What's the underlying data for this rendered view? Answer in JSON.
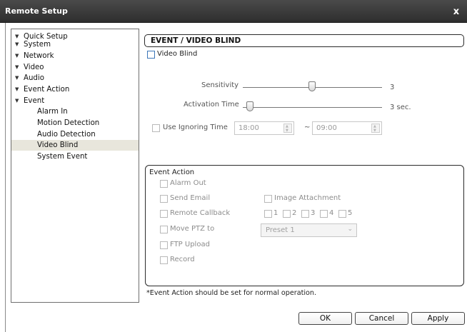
{
  "window": {
    "title": "Remote Setup",
    "close_glyph": "x"
  },
  "tree": {
    "items": [
      {
        "label": "Quick Setup",
        "arrow": "▼"
      },
      {
        "label": "System",
        "arrow": "▼"
      },
      {
        "label": "Network",
        "arrow": "▼"
      },
      {
        "label": "Video",
        "arrow": "▼"
      },
      {
        "label": "Audio",
        "arrow": "▼"
      },
      {
        "label": "Event Action",
        "arrow": "▼"
      },
      {
        "label": "Event",
        "arrow": "▼"
      },
      {
        "label": "Alarm In"
      },
      {
        "label": "Motion Detection"
      },
      {
        "label": "Audio Detection"
      },
      {
        "label": "Video Blind",
        "selected": true
      },
      {
        "label": "System Event"
      }
    ]
  },
  "panel": {
    "title": "EVENT / VIDEO BLIND",
    "enable_label": "Video Blind",
    "sensitivity": {
      "label": "Sensitivity",
      "value_text": "3"
    },
    "activation": {
      "label": "Activation Time",
      "value_text": "3 sec."
    },
    "ignoring": {
      "label": "Use Ignoring Time",
      "from": "18:00",
      "sep": "~",
      "to": "09:00"
    }
  },
  "event_action": {
    "title": "Event Action",
    "alarm_out": "Alarm Out",
    "send_email": "Send Email",
    "image_attachment": "Image Attachment",
    "remote_callback": "Remote Callback",
    "callback_numbers": [
      "1",
      "2",
      "3",
      "4",
      "5"
    ],
    "move_ptz": "Move PTZ to",
    "preset": "Preset 1",
    "ftp_upload": "FTP Upload",
    "record": "Record"
  },
  "note": "*Event Action should be set for normal operation.",
  "buttons": {
    "ok": "OK",
    "cancel": "Cancel",
    "apply": "Apply"
  },
  "colors": {
    "titlebar": "#3a3a3a",
    "selected_row": "#e8e6dc",
    "checkbox_active": "#3b76b8"
  }
}
